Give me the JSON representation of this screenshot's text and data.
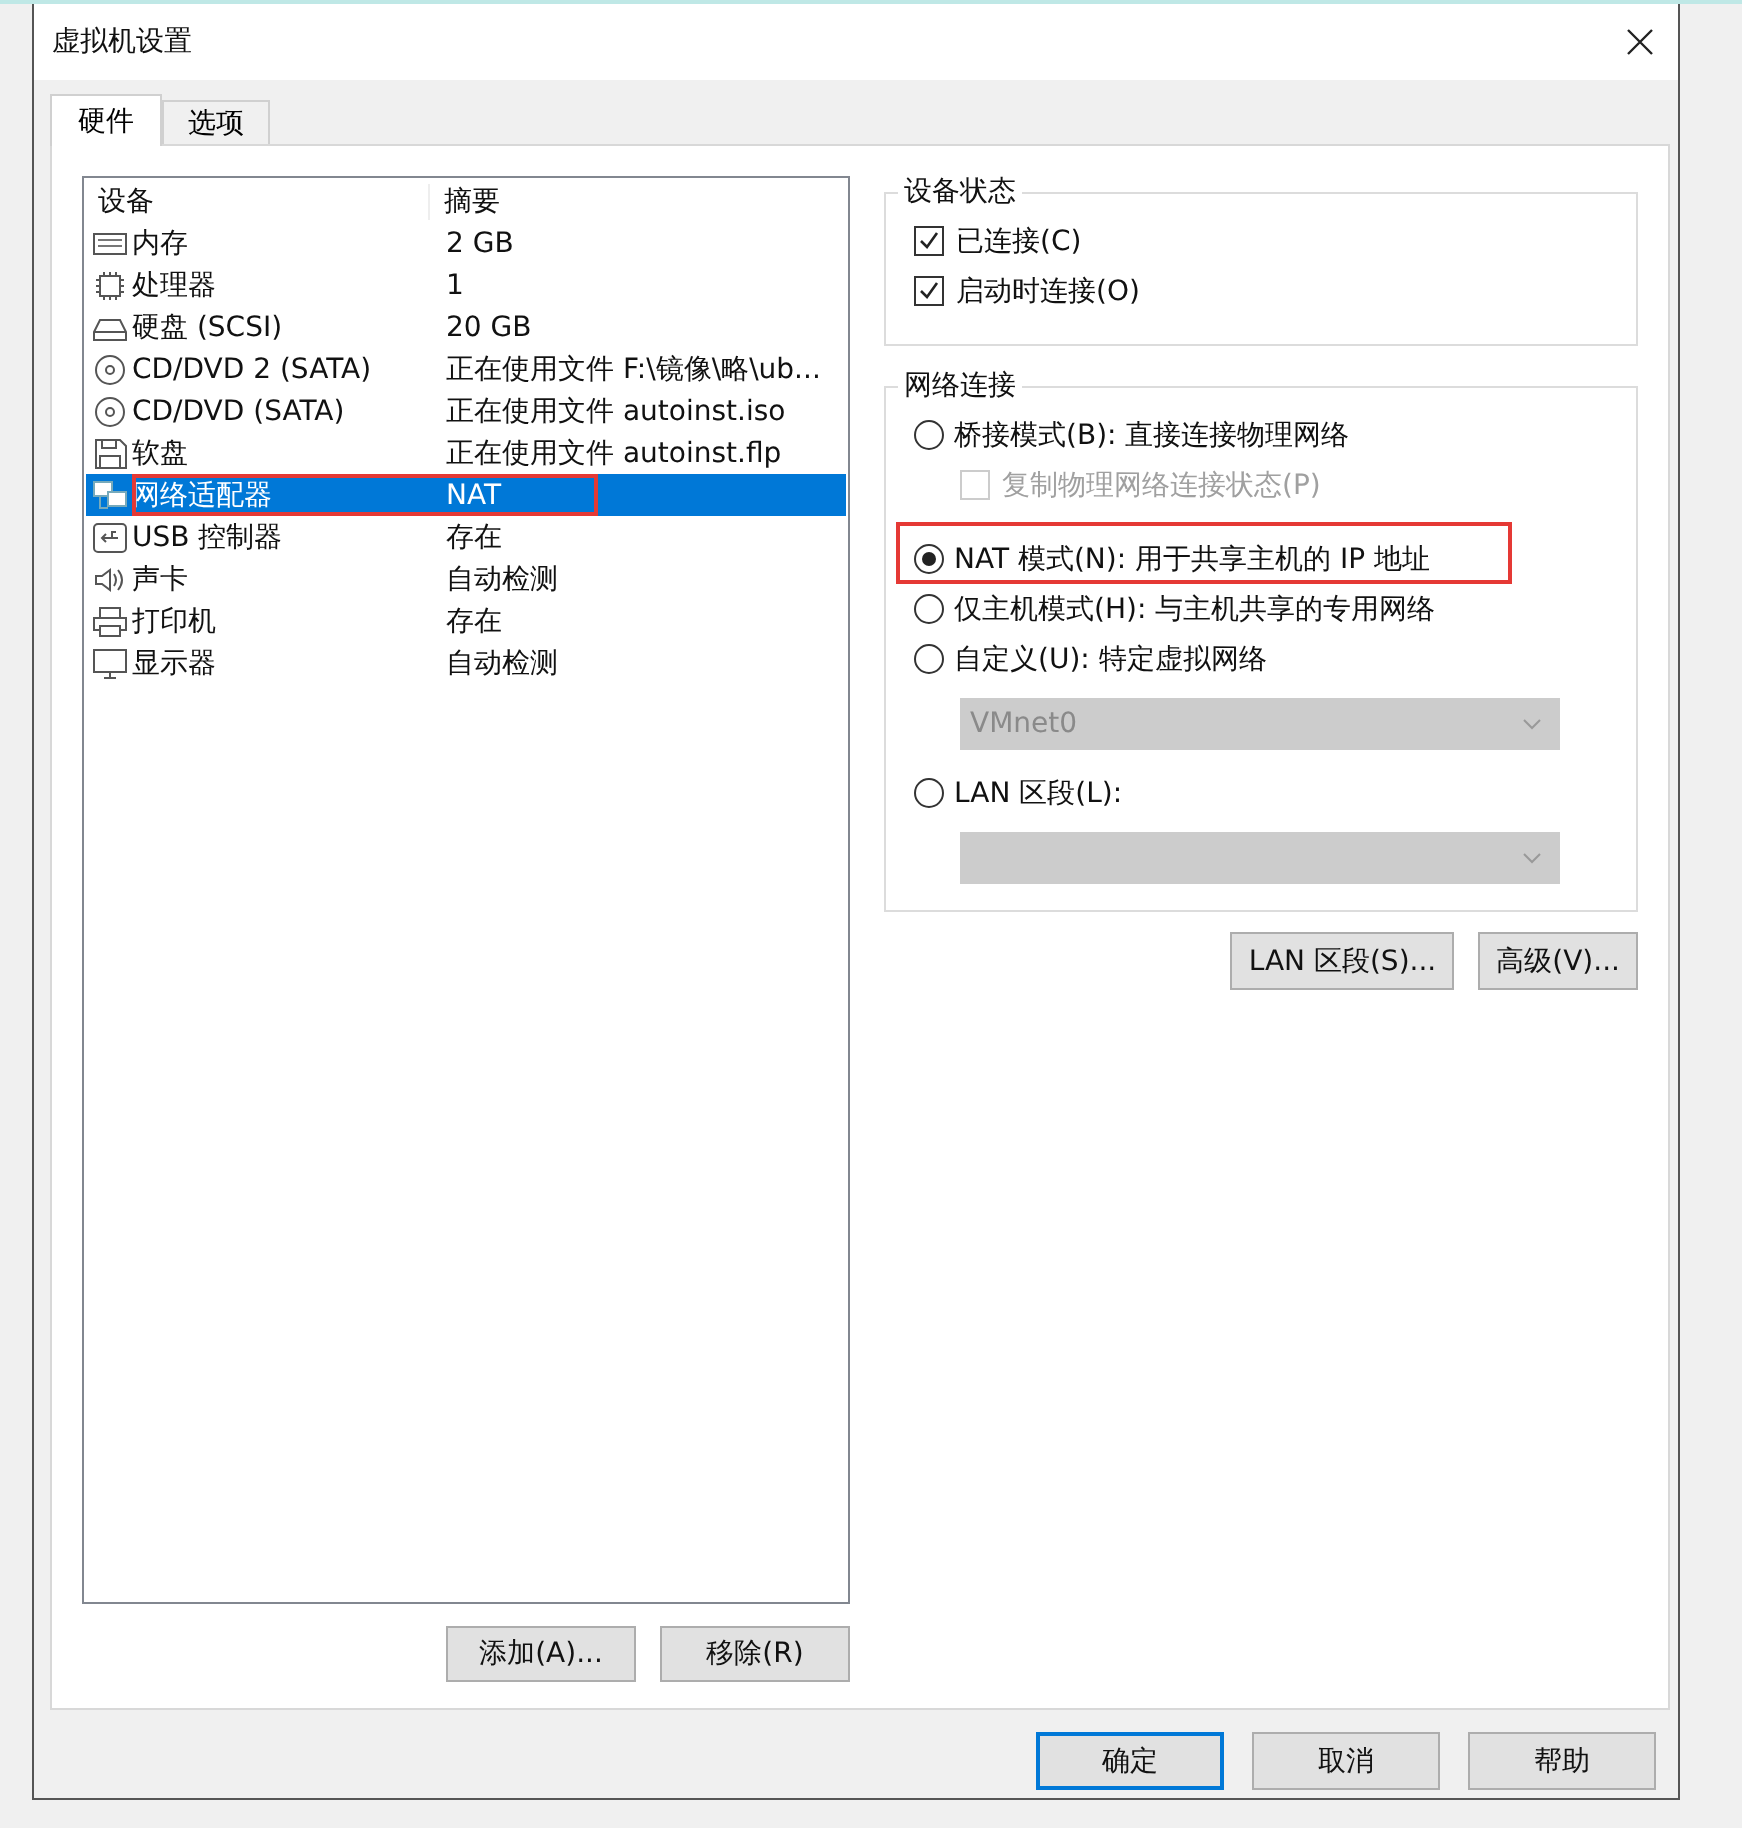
{
  "window": {
    "title": "虚拟机设置"
  },
  "tabs": [
    {
      "label": "硬件",
      "selected": true
    },
    {
      "label": "选项",
      "selected": false
    }
  ],
  "device_list": {
    "columns": [
      "设备",
      "摘要"
    ],
    "rows": [
      {
        "kind": "memory",
        "name": "内存",
        "summary": "2 GB",
        "selected": false,
        "highlighted": false
      },
      {
        "kind": "cpu",
        "name": "处理器",
        "summary": "1",
        "selected": false,
        "highlighted": false
      },
      {
        "kind": "disk",
        "name": "硬盘 (SCSI)",
        "summary": "20 GB",
        "selected": false,
        "highlighted": false
      },
      {
        "kind": "cd",
        "name": "CD/DVD 2 (SATA)",
        "summary": "正在使用文件 F:\\镜像\\略\\ub...",
        "selected": false,
        "highlighted": false
      },
      {
        "kind": "cd",
        "name": "CD/DVD (SATA)",
        "summary": "正在使用文件 autoinst.iso",
        "selected": false,
        "highlighted": false
      },
      {
        "kind": "floppy",
        "name": "软盘",
        "summary": "正在使用文件 autoinst.flp",
        "selected": false,
        "highlighted": false
      },
      {
        "kind": "network",
        "name": "网络适配器",
        "summary": "NAT",
        "selected": true,
        "highlighted": true
      },
      {
        "kind": "usb",
        "name": "USB 控制器",
        "summary": "存在",
        "selected": false,
        "highlighted": false
      },
      {
        "kind": "sound",
        "name": "声卡",
        "summary": "自动检测",
        "selected": false,
        "highlighted": false
      },
      {
        "kind": "printer",
        "name": "打印机",
        "summary": "存在",
        "selected": false,
        "highlighted": false
      },
      {
        "kind": "display",
        "name": "显示器",
        "summary": "自动检测",
        "selected": false,
        "highlighted": false
      }
    ]
  },
  "list_buttons": [
    "添加(A)...",
    "移除(R)"
  ],
  "device_status": {
    "title": "设备状态",
    "options": [
      {
        "label": "已连接(C)",
        "checked": true
      },
      {
        "label": "启动时连接(O)",
        "checked": true
      }
    ]
  },
  "network_connection": {
    "title": "网络连接",
    "options": [
      {
        "kind": "radio",
        "label": "桥接模式(B): 直接连接物理网络",
        "selected": false,
        "highlighted": false
      },
      {
        "kind": "checkbox",
        "label": "复制物理网络连接状态(P)",
        "checked": false,
        "disabled": true
      },
      {
        "kind": "radio",
        "label": "NAT 模式(N): 用于共享主机的 IP 地址",
        "selected": true,
        "highlighted": true
      },
      {
        "kind": "radio",
        "label": "仅主机模式(H): 与主机共享的专用网络",
        "selected": false,
        "highlighted": false
      },
      {
        "kind": "radio",
        "label": "自定义(U): 特定虚拟网络",
        "selected": false,
        "highlighted": false
      },
      {
        "kind": "dropdown",
        "value": "VMnet0",
        "disabled": true
      },
      {
        "kind": "radio",
        "label": "LAN 区段(L):",
        "selected": false,
        "highlighted": false
      },
      {
        "kind": "dropdown",
        "disabled": true
      }
    ]
  },
  "network_buttons": [
    "LAN 区段(S)...",
    "高级(V)..."
  ],
  "dialog_buttons": [
    {
      "label": "确定",
      "default": true
    },
    {
      "label": "取消",
      "default": false
    },
    {
      "label": "帮助",
      "default": false
    }
  ]
}
